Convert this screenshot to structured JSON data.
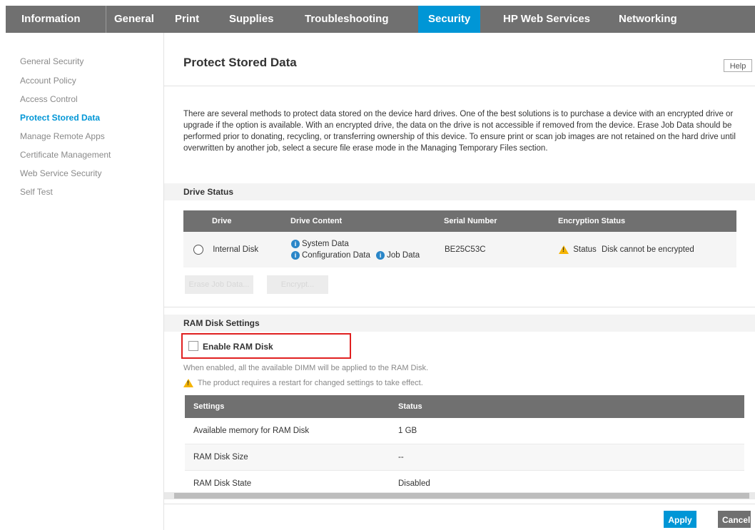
{
  "nav": {
    "tabs": [
      {
        "label": "Information"
      },
      {
        "label": "General"
      },
      {
        "label": "Print"
      },
      {
        "label": "Supplies"
      },
      {
        "label": "Troubleshooting"
      },
      {
        "label": "Security"
      },
      {
        "label": "HP Web Services"
      },
      {
        "label": "Networking"
      }
    ],
    "active_tab": "Security"
  },
  "sidebar": {
    "items": [
      {
        "label": "General Security"
      },
      {
        "label": "Account Policy"
      },
      {
        "label": "Access Control"
      },
      {
        "label": "Protect Stored Data"
      },
      {
        "label": "Manage Remote Apps"
      },
      {
        "label": "Certificate Management"
      },
      {
        "label": "Web Service Security"
      },
      {
        "label": "Self Test"
      }
    ],
    "active_item": "Protect Stored Data"
  },
  "main": {
    "title": "Protect Stored Data",
    "help_label": "Help",
    "description": "There are several methods to protect data stored on the device hard drives. One of the best solutions is to purchase a device with an encrypted drive or upgrade if the option is available. With an encrypted drive, the data on the drive is not accessible if removed from the device. Erase Job Data should be performed prior to donating, recycling, or transferring ownership of this device. To ensure print or scan job images are not retained on the hard drive until overwritten by another job, select a secure file erase mode in the Managing Temporary Files section."
  },
  "drive_status": {
    "section_title": "Drive Status",
    "headers": [
      "Drive",
      "Drive Content",
      "Serial Number",
      "Encryption Status"
    ],
    "row": {
      "drive": "Internal Disk",
      "content_system": "System Data",
      "content_config": "Configuration Data",
      "content_job": "Job Data",
      "serial": "BE25C53C",
      "status_prefix": "Status",
      "status_text": "Disk cannot be encrypted"
    },
    "button_1": "Erase Job Data...",
    "button_2": "Encrypt..."
  },
  "ram_disk": {
    "section_title": "RAM Disk Settings",
    "checkbox_label": "Enable RAM Disk",
    "checkbox_checked": false,
    "note": "When enabled, all the available DIMM will be applied to the RAM Disk.",
    "warning": "The product requires a restart for changed settings to take effect.",
    "headers": [
      "Settings",
      "Status"
    ],
    "rows": [
      {
        "setting": "Available memory for RAM Disk",
        "status": "1 GB"
      },
      {
        "setting": "RAM Disk Size",
        "status": "--"
      },
      {
        "setting": "RAM Disk State",
        "status": "Disabled"
      }
    ]
  },
  "footer": {
    "apply_label": "Apply",
    "cancel_label": "Cancel"
  },
  "colors": {
    "nav_bg": "#707070",
    "accent": "#0096d6",
    "highlight_box": "#e02020",
    "warning": "#f5b400"
  },
  "icons": [
    "info-icon",
    "warning-icon",
    "radio-button",
    "checkbox"
  ]
}
